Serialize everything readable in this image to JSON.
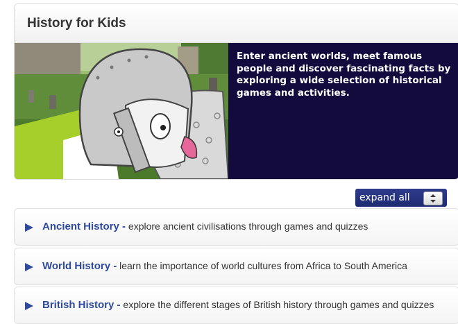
{
  "card": {
    "title": "History for Kids",
    "banner_text": "Enter ancient worlds, meet famous people and discover fascinating facts by exploring a wide selection of historical games and activities."
  },
  "controls": {
    "expand_label": "expand all"
  },
  "sections": [
    {
      "title": "Ancient History -",
      "description": "explore ancient civilisations through games and quizzes"
    },
    {
      "title": "World History -",
      "description": "learn the importance of world cultures from Africa to South America"
    },
    {
      "title": "British History -",
      "description": "explore the different stages of British history through games and quizzes"
    }
  ],
  "colors": {
    "banner_bg": "#130a3e",
    "link_blue": "#2d4a9c",
    "button_blue": "#2e3c8c"
  }
}
